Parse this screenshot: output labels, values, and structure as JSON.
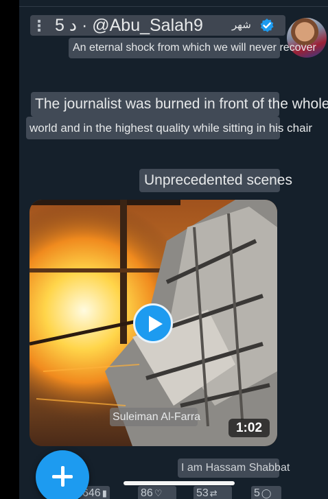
{
  "header": {
    "time_ago": "5 د",
    "handle": "@Abu_Salah9",
    "display_name": "شهر",
    "verified_icon": "verified-badge-icon",
    "accent_color": "#1d9bf0"
  },
  "tweet": {
    "lines": [
      "An eternal shock from which we will never recover",
      "The journalist was burned in front of the whole",
      "world and in the highest quality while sitting in his chair",
      "Unprecedented scenes"
    ],
    "video": {
      "caption": "Suleiman Al-Farra",
      "duration": "1:02",
      "play_icon": "play-icon"
    },
    "footer_caption": "I am Hassam Shabbat"
  },
  "actions": {
    "views": "646",
    "likes": "86",
    "retweets": "53",
    "replies": "5"
  },
  "compose_button_icon": "plus-icon"
}
